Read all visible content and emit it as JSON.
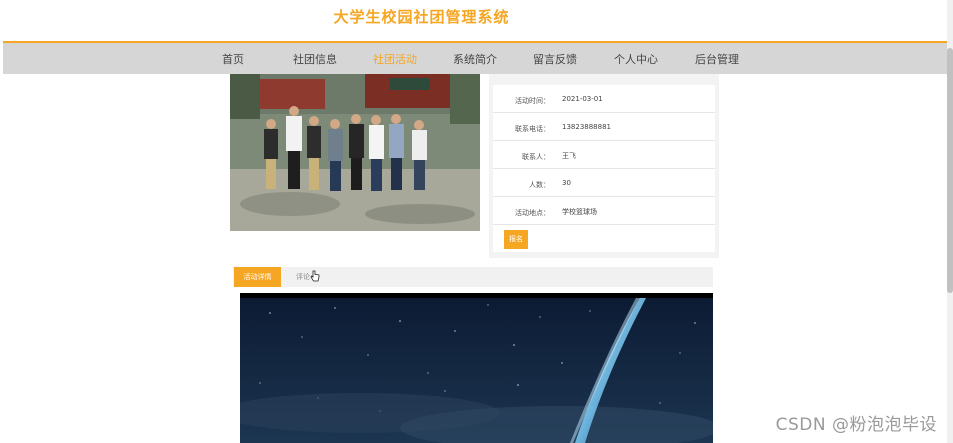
{
  "header": {
    "site_title": "大学生校园社团管理系统"
  },
  "nav": {
    "items": [
      {
        "label": "首页"
      },
      {
        "label": "社团信息"
      },
      {
        "label": "社团活动"
      },
      {
        "label": "系统简介"
      },
      {
        "label": "留言反馈"
      },
      {
        "label": "个人中心"
      },
      {
        "label": "后台管理"
      }
    ],
    "active_index": 2
  },
  "activity": {
    "details": [
      {
        "label": "活动时间：",
        "value": "2021-03-01"
      },
      {
        "label": "联系电话：",
        "value": "13823888881"
      },
      {
        "label": "联系人：",
        "value": "王飞"
      },
      {
        "label": "人数：",
        "value": "30"
      },
      {
        "label": "活动地点：",
        "value": "学校篮球场"
      }
    ],
    "signup_label": "报名"
  },
  "tabs": [
    {
      "label": "活动详情"
    },
    {
      "label": "评论"
    }
  ],
  "watermark": "CSDN @粉泡泡毕设",
  "colors": {
    "accent": "#f5a623",
    "navbar": "#d6d6d6"
  }
}
